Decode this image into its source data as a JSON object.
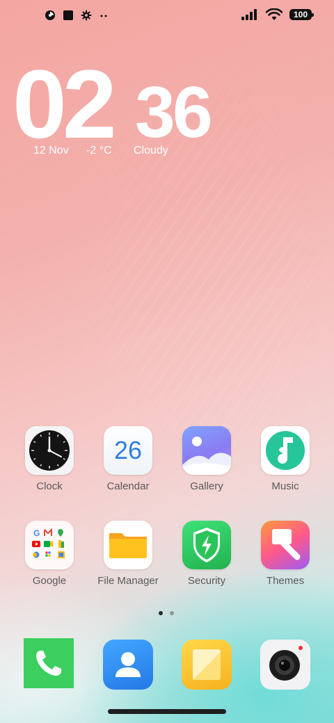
{
  "status": {
    "battery": "100"
  },
  "widget": {
    "hour": "02",
    "minute": "36",
    "date": "12 Nov",
    "temperature": "-2 °C",
    "condition": "Cloudy"
  },
  "apps": [
    {
      "label": "Clock",
      "icon": "clock-icon"
    },
    {
      "label": "Calendar",
      "icon": "calendar-icon",
      "day": "26"
    },
    {
      "label": "Gallery",
      "icon": "gallery-icon"
    },
    {
      "label": "Music",
      "icon": "music-icon"
    },
    {
      "label": "Google",
      "icon": "google-folder-icon"
    },
    {
      "label": "File Manager",
      "icon": "folder-icon"
    },
    {
      "label": "Security",
      "icon": "shield-icon"
    },
    {
      "label": "Themes",
      "icon": "paint-brush-icon"
    }
  ],
  "dock": [
    {
      "icon": "phone-icon"
    },
    {
      "icon": "contacts-icon"
    },
    {
      "icon": "notes-icon"
    },
    {
      "icon": "camera-icon"
    }
  ],
  "pages": {
    "count": 2,
    "current": 1
  },
  "colors": {
    "phone_green": "#3ccf5f",
    "contacts_blue": "#2f8cf0",
    "notes_yellow": "#f7c531",
    "security_green": "#2fc85a"
  }
}
